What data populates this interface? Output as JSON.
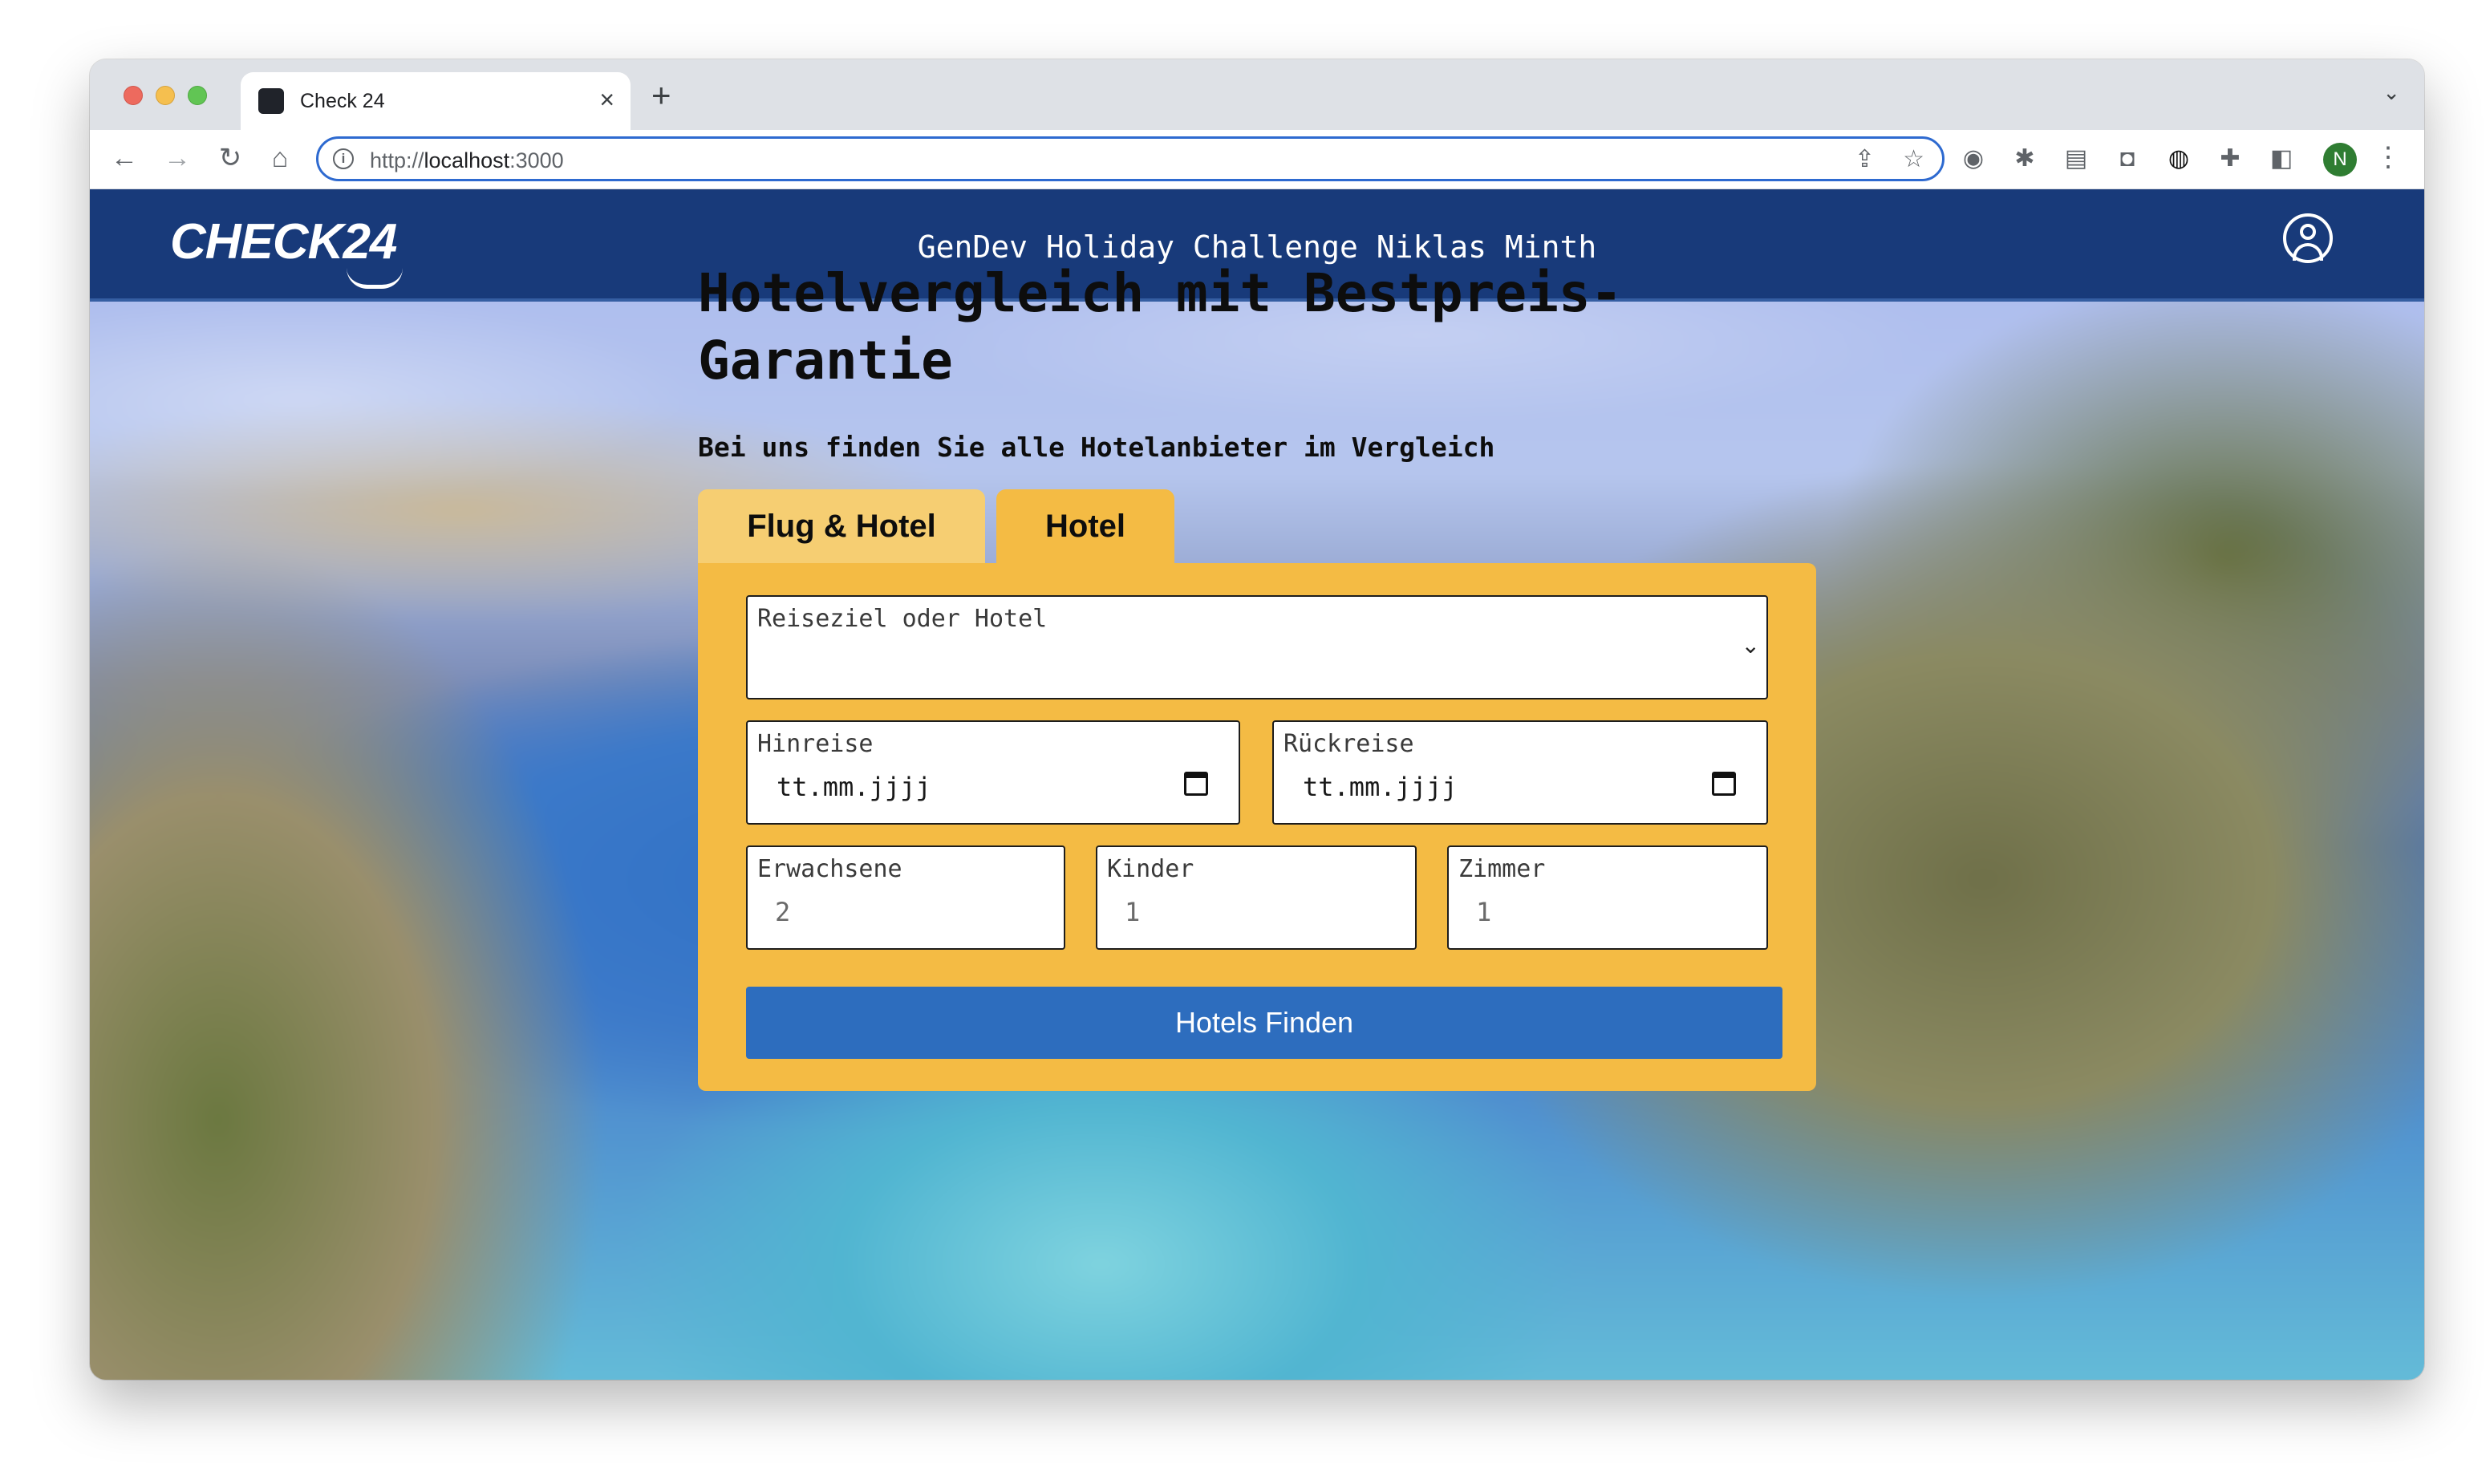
{
  "browser": {
    "tab_title": "Check 24",
    "new_tab_symbol": "+",
    "close_symbol": "×",
    "url_scheme": "http://",
    "url_host": "localhost",
    "url_port": ":3000",
    "profile_initial": "N"
  },
  "navbar": {
    "logo": "CHECK24",
    "title": "GenDev Holiday Challenge Niklas Minth"
  },
  "hero": {
    "headline": "Hotelvergleich mit Bestpreis-Garantie",
    "subline": "Bei uns finden Sie alle Hotelanbieter im Vergleich"
  },
  "tabs": {
    "flight_hotel": "Flug & Hotel",
    "hotel": "Hotel"
  },
  "form": {
    "destination_label": "Reiseziel oder Hotel",
    "departure_label": "Hinreise",
    "departure_value": "tt.mm.jjjj",
    "return_label": "Rückreise",
    "return_value": "tt.mm.jjjj",
    "adults_label": "Erwachsene",
    "adults_value": "2",
    "children_label": "Kinder",
    "children_value": "1",
    "rooms_label": "Zimmer",
    "rooms_value": "1",
    "submit_label": "Hotels Finden"
  },
  "colors": {
    "navbar": "#183a7a",
    "form_panel": "#f4bb44",
    "tab_inactive": "#f6ce72",
    "submit": "#2d6dbe"
  }
}
